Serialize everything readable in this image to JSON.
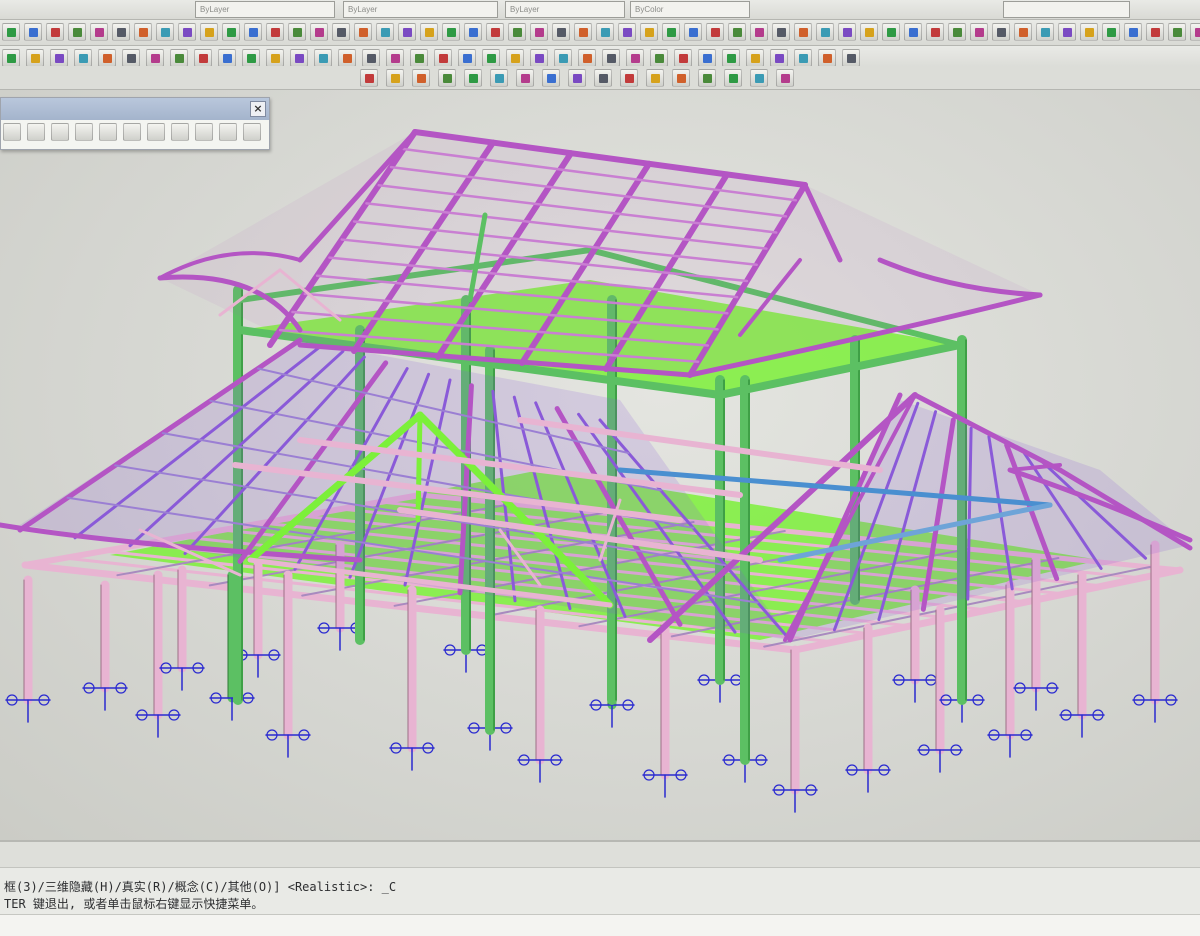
{
  "toolbar": {
    "layer_combo_1": "ByLayer",
    "layer_combo_2": "ByLayer",
    "layer_combo_3": "ByLayer",
    "color_combo": "ByColor"
  },
  "command_line": {
    "line1": "框(3)/三维隐藏(H)/真实(R)/概念(C)/其他(O)] <Realistic>: _C",
    "line2": "TER 键退出, 或者单击鼠标右键显示快捷菜单。"
  },
  "colors": {
    "roof_member": "#b455c4",
    "beam_pink": "#e8b4d2",
    "column_green": "#5cc063",
    "floor_green": "#7cf03a",
    "brace_purple": "#8a5ad8",
    "support_blue": "#2a2ad0"
  },
  "icons": [
    "layer-icon",
    "move-icon",
    "rotate-icon",
    "render-icon",
    "sphere-icon",
    "dimension-icon",
    "snap-icon",
    "close-icon"
  ]
}
